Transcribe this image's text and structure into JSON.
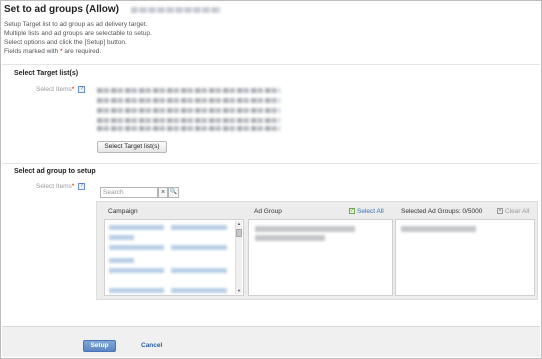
{
  "header": {
    "title": "Set to ad groups (Allow)"
  },
  "intro": {
    "line1": "Setup Target list to ad group as ad delivery target.",
    "line2": "Multiple lists and ad groups are selectable to setup.",
    "line3": "Select options and click the [Setup] button.",
    "line4_prefix": "Fields marked with ",
    "line4_star": "*",
    "line4_suffix": " are required."
  },
  "target_section": {
    "title": "Select Target list(s)",
    "label": "Select Items",
    "required_mark": "*",
    "help_icon": "?",
    "button_label": "Select Target list(s)"
  },
  "adgroup_section": {
    "title": "Select ad group to setup",
    "label": "Select Items",
    "required_mark": "*",
    "help_icon": "?",
    "search_placeholder": "Search",
    "clear_glyph": "×",
    "search_glyph": "🔍",
    "columns": {
      "campaign": "Campaign",
      "ad_group": "Ad Group",
      "select_all": "Select All",
      "selected": "Selected Ad Groups: 0/5000",
      "clear_all": "Clear All"
    }
  },
  "footer": {
    "setup_label": "Setup",
    "cancel_label": "Cancel"
  }
}
